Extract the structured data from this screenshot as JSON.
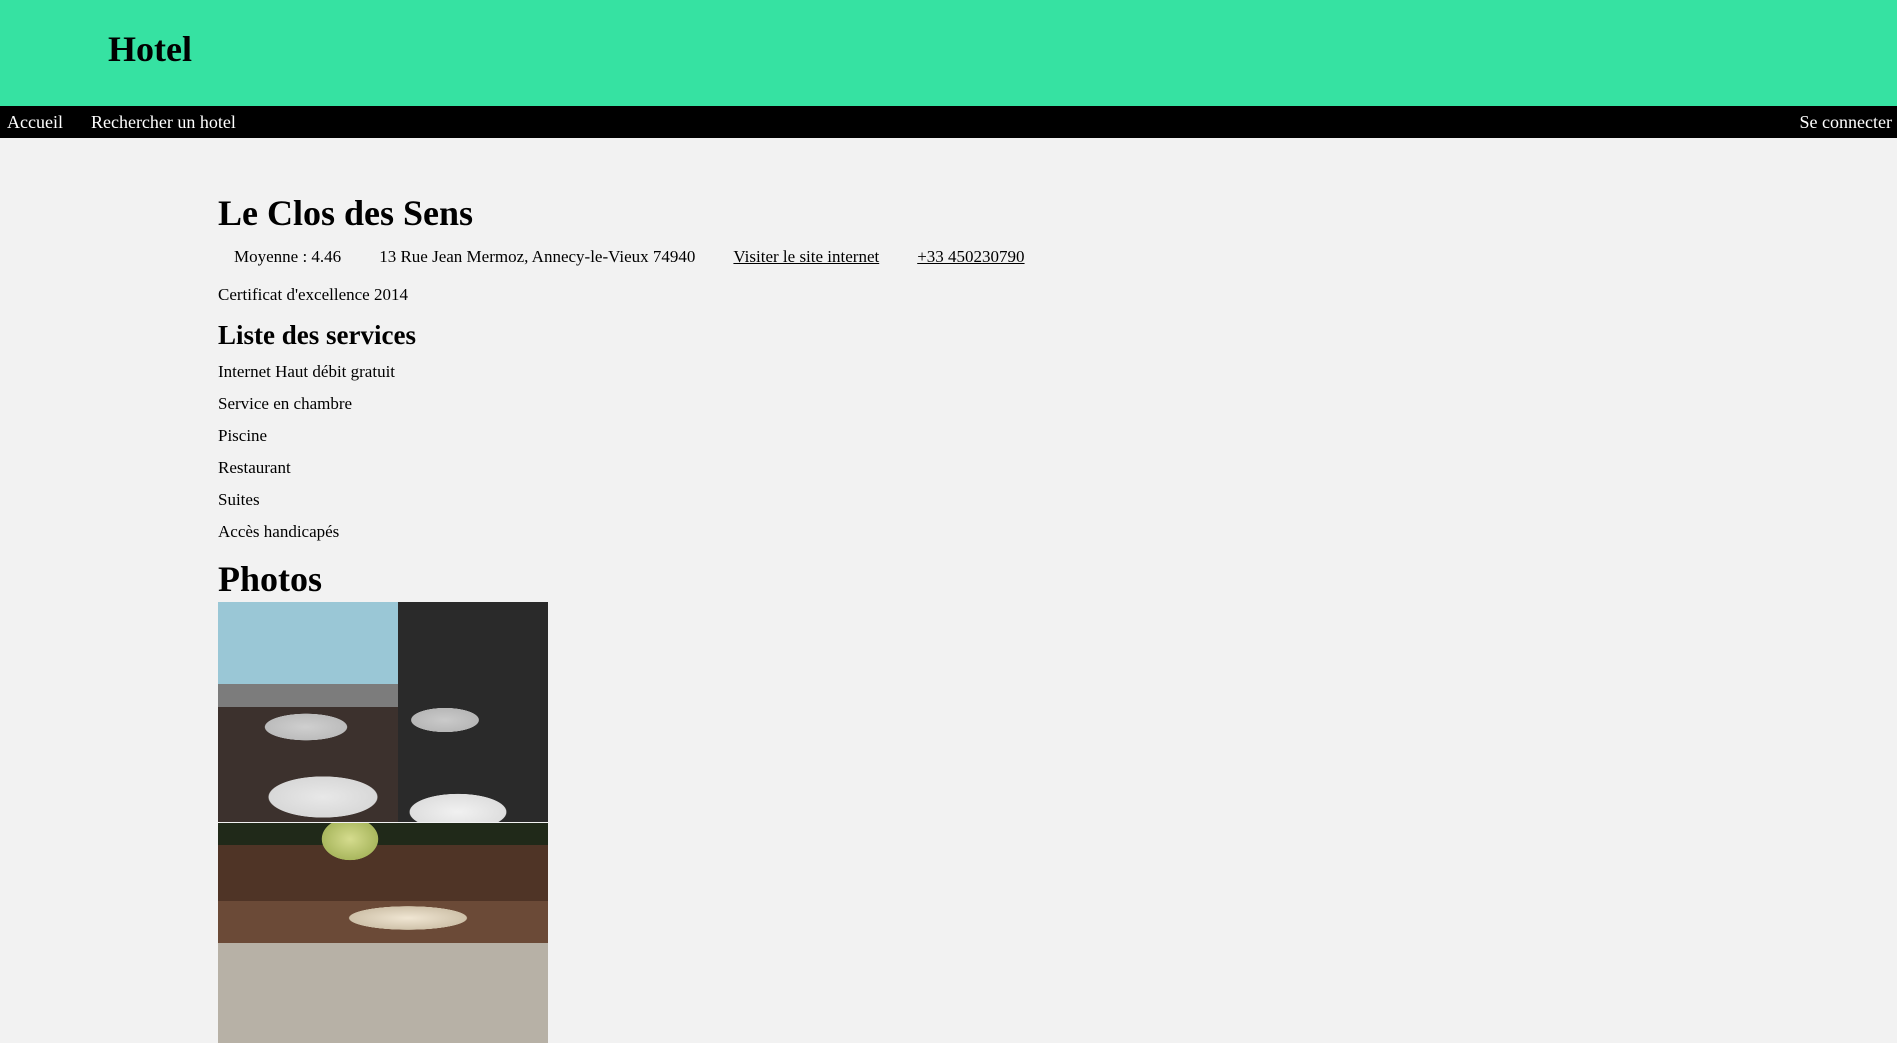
{
  "header": {
    "brand": "Hotel"
  },
  "nav": {
    "items": [
      {
        "label": "Accueil"
      },
      {
        "label": "Rechercher un hotel"
      }
    ],
    "login": "Se connecter"
  },
  "hotel": {
    "name": "Le Clos des Sens",
    "rating": "Moyenne : 4.46",
    "address": "13 Rue Jean Mermoz, Annecy-le-Vieux 74940",
    "website_link": "Visiter le site internet",
    "phone": "+33 450230790",
    "certificate": "Certificat d'excellence 2014",
    "services_title": "Liste des services",
    "services": [
      "Internet Haut débit gratuit",
      "Service en chambre",
      "Piscine",
      "Restaurant",
      "Suites",
      "Accès handicapés"
    ],
    "photos_title": "Photos"
  },
  "colors": {
    "header_bg": "#36e2a2",
    "nav_bg": "#000000",
    "page_bg": "#f2f2f2"
  }
}
